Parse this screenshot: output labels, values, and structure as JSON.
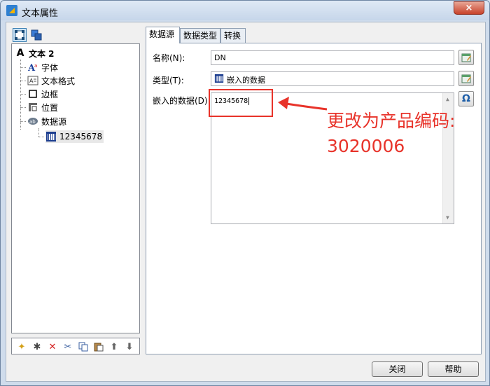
{
  "window": {
    "title": "文本属性",
    "close_label": "×"
  },
  "left_toolbar": {
    "buttons": [
      "object-view",
      "layer-view"
    ]
  },
  "tree": {
    "root": "文本 2",
    "children": [
      {
        "label": "字体",
        "icon": "font-icon"
      },
      {
        "label": "文本格式",
        "icon": "text-format-icon"
      },
      {
        "label": "边框",
        "icon": "border-icon"
      },
      {
        "label": "位置",
        "icon": "position-icon"
      },
      {
        "label": "数据源",
        "icon": "datasource-icon"
      }
    ],
    "leaf": "12345678"
  },
  "tabs": [
    "数据源",
    "数据类型",
    "转换"
  ],
  "form": {
    "name_label": "名称(N):",
    "name_value": "DN",
    "type_label": "类型(T):",
    "type_value": "嵌入的数据",
    "data_label": "嵌入的数据(D):",
    "data_value": "12345678",
    "omega": "Ω"
  },
  "annotation": {
    "line1": "更改为产品编码:",
    "line2": "3020006",
    "color": "#e8332a"
  },
  "footer": {
    "close": "关闭",
    "help": "帮助"
  }
}
